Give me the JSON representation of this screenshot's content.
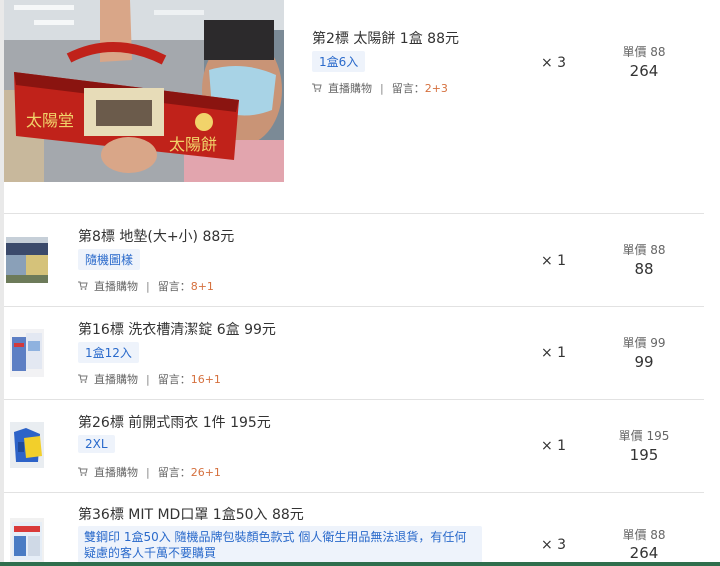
{
  "meta_labels": {
    "live_purchase": "直播購物",
    "note_prefix": "留言：",
    "unit_price_prefix": "單價 "
  },
  "items": [
    {
      "title": "第2標 太陽餅 1盒 88元",
      "spec": "1盒6入",
      "note": "2+3",
      "qty": "× 3",
      "unit_price": "88",
      "subtotal": "264"
    },
    {
      "title": "第8標 地墊(大+小) 88元",
      "spec": "隨機圖樣",
      "note": "8+1",
      "qty": "× 1",
      "unit_price": "88",
      "subtotal": "88"
    },
    {
      "title": "第16標 洗衣槽清潔錠 6盒 99元",
      "spec": "1盒12入",
      "note": "16+1",
      "qty": "× 1",
      "unit_price": "99",
      "subtotal": "99"
    },
    {
      "title": "第26標 前開式雨衣 1件 195元",
      "spec": "2XL",
      "note": "26+1",
      "qty": "× 1",
      "unit_price": "195",
      "subtotal": "195"
    },
    {
      "title": "第36標 MIT MD口罩 1盒50入 88元",
      "spec": "雙鋼印 1盒50入 隨機品牌包裝顏色款式 個人衛生用品無法退貨，有任何疑慮的客人千萬不要購買",
      "qty": "× 3",
      "unit_price": "88",
      "subtotal": "264"
    }
  ]
}
